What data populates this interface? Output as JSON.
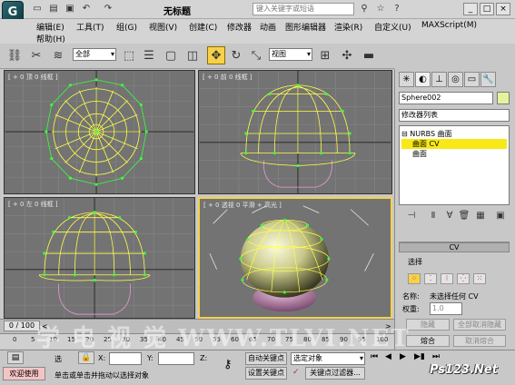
{
  "window": {
    "title": "无标题",
    "search_placeholder": "键入关键字或短语",
    "menus": [
      "编辑(E)",
      "工具(T)",
      "组(G)",
      "视图(V)",
      "创建(C)",
      "修改器",
      "动画",
      "图形编辑器",
      "渲染(R)",
      "自定义(U)",
      "MAXScript(M)",
      "帮助(H)"
    ]
  },
  "toolbar": {
    "filter_value": "全部",
    "refcoord_value": "视图"
  },
  "viewports": [
    {
      "label": "[ + 0 顶 0 线框 ]"
    },
    {
      "label": "[ + 0 前 0 线框 ]"
    },
    {
      "label": "[ + 0 左 0 线框 ]"
    },
    {
      "label": "[ + 0 透视 0 平滑 + 高光 ]"
    }
  ],
  "panel": {
    "object_name": "Sphere002",
    "modifier_list": "修改器列表",
    "stack": [
      "NURBS 曲面",
      "曲面 CV",
      "曲面"
    ],
    "selected_stack_index": 1,
    "rollout_title": "CV",
    "selection_label": "选择",
    "name_label": "名称:",
    "name_value": "未选择任何 CV",
    "weight_label": "权重:",
    "weight_value": "1.0",
    "hide_btn": "隐藏",
    "unhide_all_btn": "全部取消隐藏",
    "fuse_btn": "熔合",
    "unfuse_btn": "取消熔合"
  },
  "timeline": {
    "frame_display": "0 / 100",
    "ticks": [
      "0",
      "5",
      "10",
      "15",
      "20",
      "25",
      "30",
      "35",
      "40",
      "45",
      "50",
      "55",
      "60",
      "65",
      "70",
      "75",
      "80",
      "85",
      "90",
      "95",
      "100"
    ]
  },
  "status": {
    "select_label": "选",
    "x_label": "X:",
    "y_label": "Y:",
    "z_label": "Z:",
    "auto_key": "自动关键点",
    "set_key": "设置关键点",
    "selected_object": "选定对象",
    "key_filter": "关键点过滤器...",
    "welcome": "欢迎使用",
    "prompt": "单击或单击并拖动以选择对象"
  },
  "watermark": "学 电 视 觉 WWW.TLVI.NET",
  "logo": "Ps123.Net",
  "colors": {
    "accent_yellow": "#f6d14a",
    "wire_yellow": "#ffff4a",
    "cv_green": "#3cff3c",
    "viewport_bg": "#737373"
  }
}
